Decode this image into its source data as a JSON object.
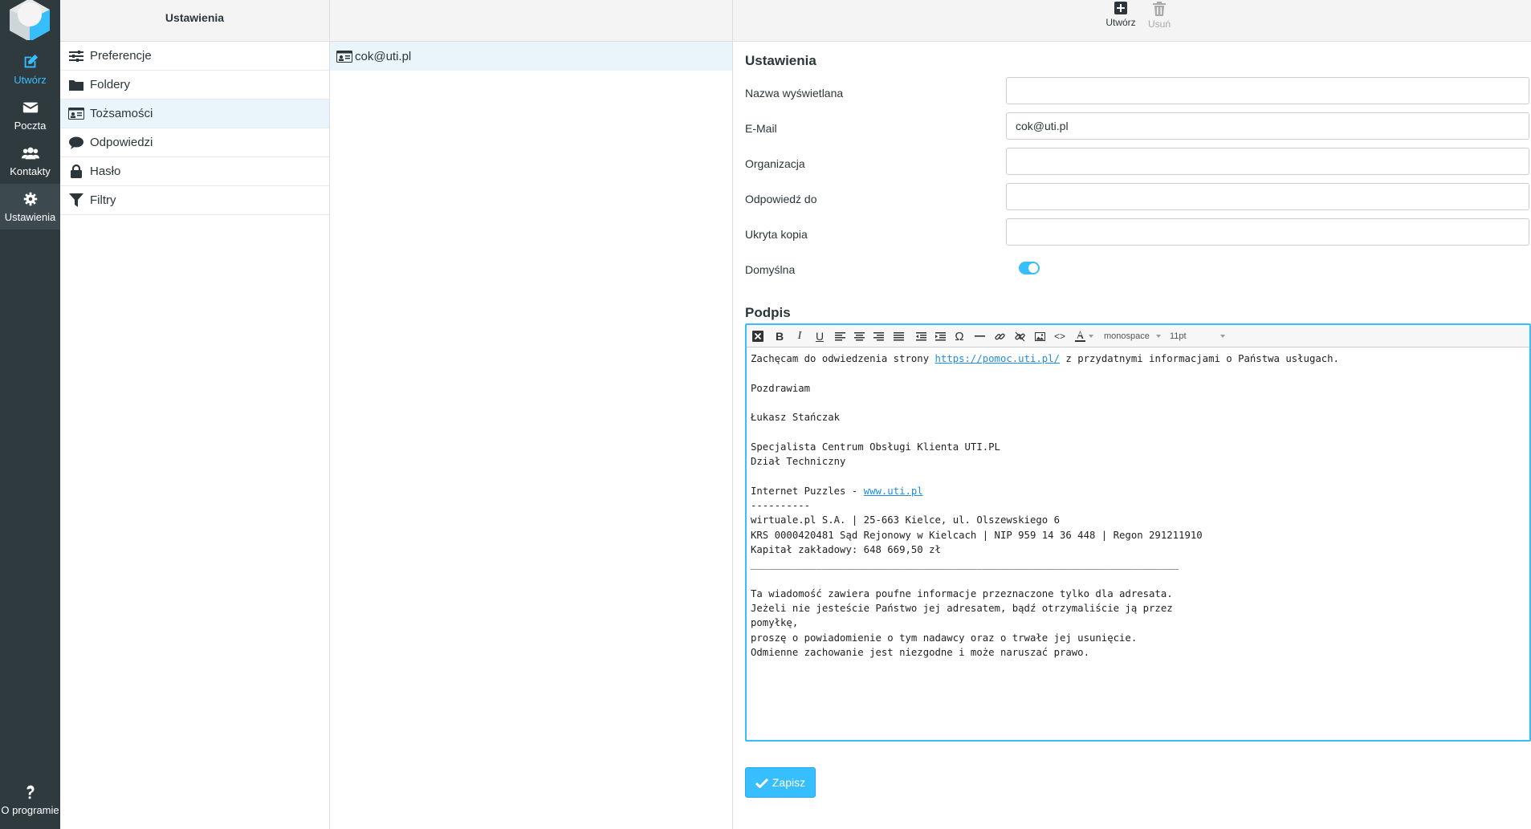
{
  "nav": {
    "items": [
      {
        "label": "Utwórz",
        "icon": "compose-icon"
      },
      {
        "label": "Poczta",
        "icon": "envelope-icon"
      },
      {
        "label": "Kontakty",
        "icon": "users-icon"
      },
      {
        "label": "Ustawienia",
        "icon": "gear-icon"
      }
    ],
    "about": {
      "label": "O programie",
      "icon": "question-icon"
    }
  },
  "settings_panel": {
    "title": "Ustawienia",
    "items": [
      {
        "label": "Preferencje",
        "icon": "sliders-icon"
      },
      {
        "label": "Foldery",
        "icon": "folder-icon"
      },
      {
        "label": "Tożsamości",
        "icon": "id-card-icon"
      },
      {
        "label": "Odpowiedzi",
        "icon": "comment-icon"
      },
      {
        "label": "Hasło",
        "icon": "lock-icon"
      },
      {
        "label": "Filtry",
        "icon": "filter-icon"
      }
    ],
    "selected": "Tożsamości"
  },
  "identities": {
    "items": [
      {
        "label": "cok@uti.pl",
        "icon": "id-card-icon"
      }
    ]
  },
  "toolbar": {
    "create_label": "Utwórz",
    "delete_label": "Usuń"
  },
  "form": {
    "section_title": "Ustawienia",
    "fields": {
      "display_name": {
        "label": "Nazwa wyświetlana",
        "value": ""
      },
      "email": {
        "label": "E-Mail",
        "value": "cok@uti.pl"
      },
      "organization": {
        "label": "Organizacja",
        "value": ""
      },
      "reply_to": {
        "label": "Odpowiedź do",
        "value": ""
      },
      "bcc": {
        "label": "Ukryta kopia",
        "value": ""
      },
      "default": {
        "label": "Domyślna",
        "value": true
      }
    },
    "signature_title": "Podpis",
    "editor_toolbar": {
      "font_family": "monospace",
      "font_size": "11pt"
    },
    "signature": {
      "line1_pre": "Zachęcam do odwiedzenia strony ",
      "line1_link": "https://pomoc.uti.pl/",
      "line1_post": " z przydatnymi informacjami o Państwa usługach.",
      "greeting": "Pozdrawiam",
      "name": "Łukasz Stańczak",
      "role1": "Specjalista Centrum Obsługi Klienta UTI.PL",
      "role2": "Dział Techniczny",
      "company_pre": "Internet Puzzles - ",
      "company_link": "www.uti.pl",
      "separator1": "----------",
      "address": "wirtuale.pl S.A. | 25-663 Kielce, ul. Olszewskiego 6",
      "krs": "KRS 0000420481 Sąd Rejonowy w Kielcach | NIP 959 14 36 448 | Regon 291211910",
      "capital": "Kapitał zakładowy: 648 669,50 zł",
      "separator2": "________________________________________________________________________",
      "disclaimer1": "Ta wiadomość zawiera poufne informacje przeznaczone tylko dla adresata.",
      "disclaimer2": "Jeżeli nie jesteście Państwo jej adresatem, bądź otrzymaliście ją przez",
      "disclaimer3": "pomyłkę,",
      "disclaimer4": "proszę o powiadomienie o tym nadawcy oraz o trwałe jej usunięcie.",
      "disclaimer5": "Odmienne zachowanie jest niezgodne i może naruszać prawo."
    },
    "save_label": "Zapisz"
  },
  "colors": {
    "nav_bg": "#2f3a3f",
    "accent": "#37beff",
    "selected_row": "#eaf4fb"
  }
}
